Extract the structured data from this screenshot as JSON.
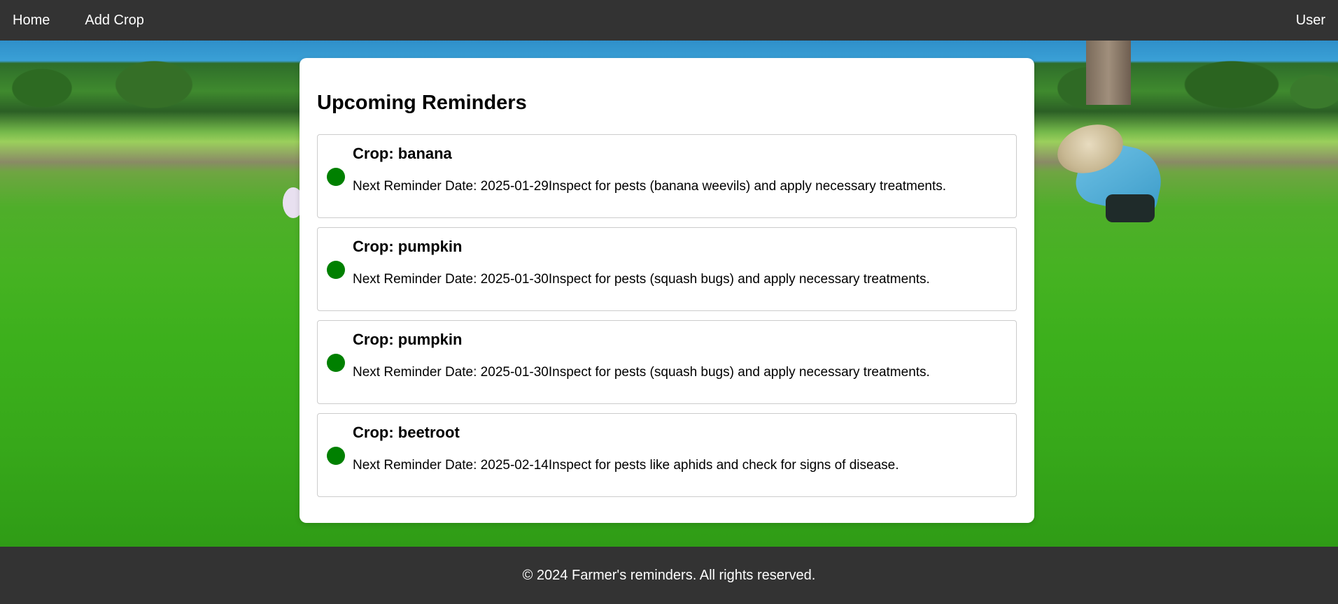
{
  "nav": {
    "home_label": "Home",
    "add_crop_label": "Add Crop",
    "user_label": "User"
  },
  "main": {
    "title": "Upcoming Reminders",
    "reminders": [
      {
        "crop": "Crop: banana",
        "text": "Next Reminder Date: 2025-01-29Inspect for pests (banana weevils) and apply necessary treatments.",
        "status_color": "#008000"
      },
      {
        "crop": "Crop: pumpkin",
        "text": "Next Reminder Date: 2025-01-30Inspect for pests (squash bugs) and apply necessary treatments.",
        "status_color": "#008000"
      },
      {
        "crop": "Crop: pumpkin",
        "text": "Next Reminder Date: 2025-01-30Inspect for pests (squash bugs) and apply necessary treatments.",
        "status_color": "#008000"
      },
      {
        "crop": "Crop: beetroot",
        "text": "Next Reminder Date: 2025-02-14Inspect for pests like aphids and check for signs of disease.",
        "status_color": "#008000"
      }
    ]
  },
  "footer": {
    "text": "© 2024 Farmer's reminders. All rights reserved."
  },
  "colors": {
    "nav_background": "#333333",
    "status_dot": "#008000",
    "card_background": "#ffffff"
  }
}
